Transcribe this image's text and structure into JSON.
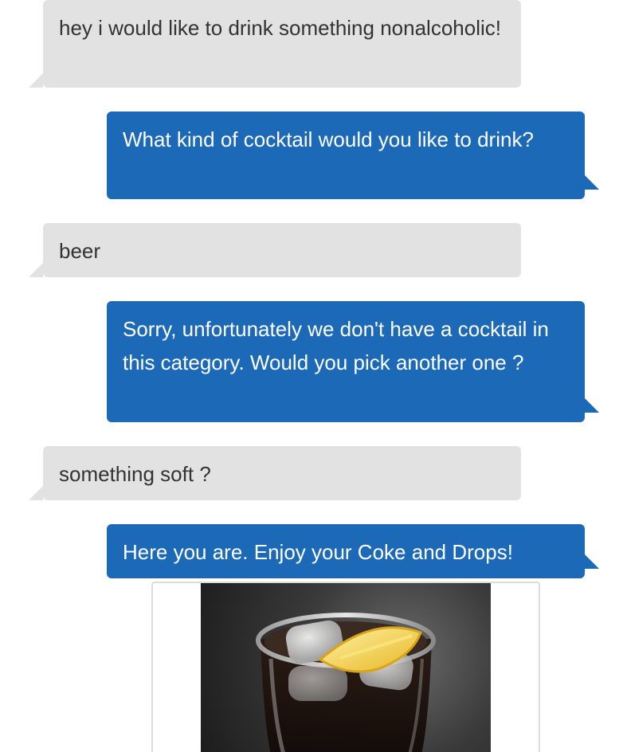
{
  "messages": [
    {
      "role": "user",
      "text": "hey i would like to drink something nonalcoholic!"
    },
    {
      "role": "bot",
      "text": "What kind of cocktail would you like to drink?"
    },
    {
      "role": "user",
      "text": "beer"
    },
    {
      "role": "bot",
      "text": "Sorry, unfortunately we don't have a cocktail in this category. Would you pick another one ?"
    },
    {
      "role": "user",
      "text": "something soft ?"
    },
    {
      "role": "bot",
      "text": "Here you are. Enjoy your Coke and Drops!"
    }
  ],
  "attachment": {
    "icon": "drink-image-icon"
  },
  "colors": {
    "user_bubble": "#e2e2e2",
    "bot_bubble": "#1c69b8",
    "user_text": "#333333",
    "bot_text": "#ffffff"
  }
}
